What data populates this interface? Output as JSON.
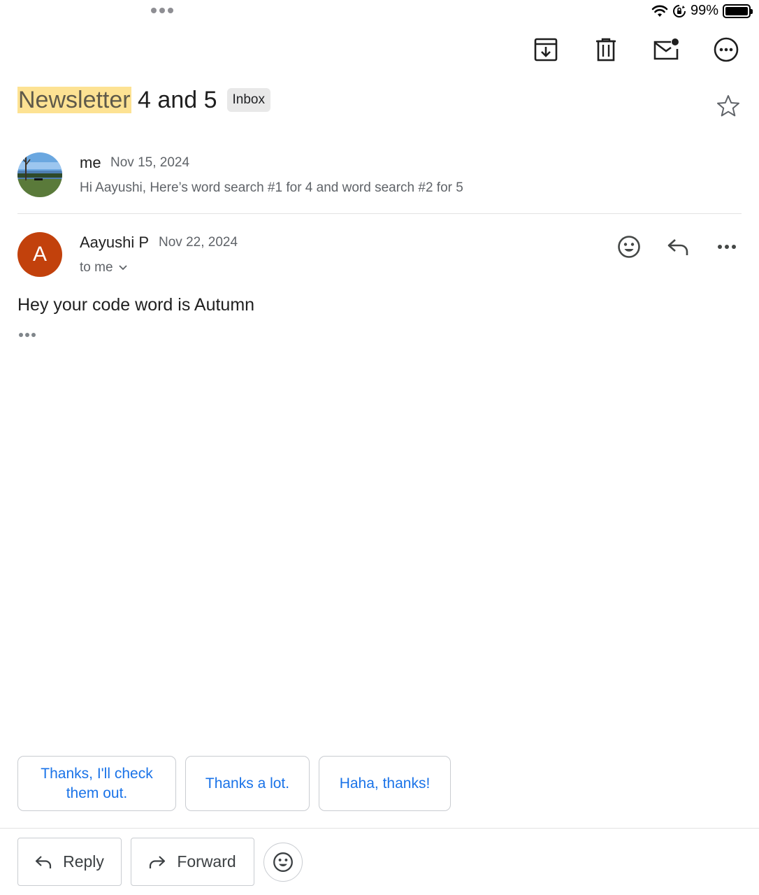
{
  "status_bar": {
    "battery_text": "99%"
  },
  "toolbar": {
    "archive_icon": "archive-icon",
    "delete_icon": "trash-icon",
    "mark_unread_icon": "mark-unread-icon",
    "more_icon": "more-circle-icon"
  },
  "subject": {
    "highlighted": "Newsletter",
    "rest": " 4 and 5",
    "label": "Inbox"
  },
  "messages": [
    {
      "sender": "me",
      "date": "Nov 15, 2024",
      "snippet": "Hi Aayushi, Here’s word search #1 for 4 and word search #2 for 5"
    },
    {
      "sender": "Aayushi P",
      "initial": "A",
      "date": "Nov 22, 2024",
      "recipients": "to me",
      "body": "Hey your code word is Autumn",
      "avatar_color": "#c2410c"
    }
  ],
  "smart_replies": [
    {
      "label": "Thanks, I'll check them out."
    },
    {
      "label": "Thanks a lot."
    },
    {
      "label": "Haha, thanks!"
    }
  ],
  "bottom_bar": {
    "reply_label": "Reply",
    "forward_label": "Forward"
  },
  "colors": {
    "accent": "#1a73e8",
    "highlight": "#fde293"
  }
}
